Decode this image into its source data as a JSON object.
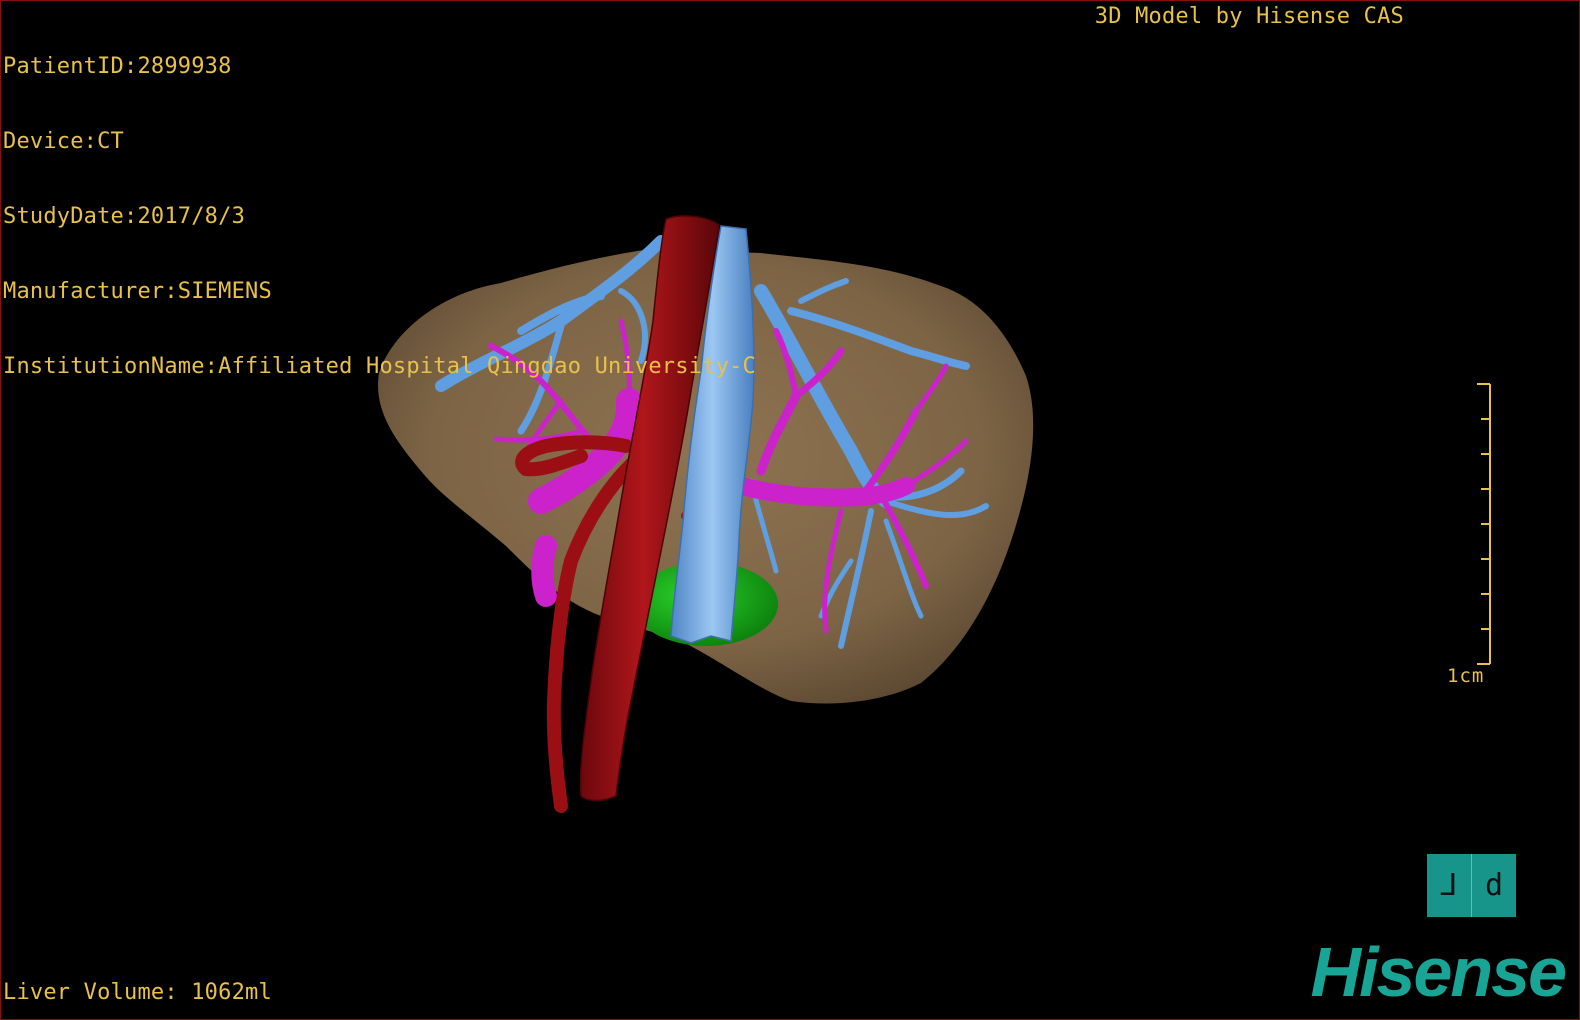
{
  "dicom_info": {
    "patient_id": "PatientID:2899938",
    "device": "Device:CT",
    "study_date": "StudyDate:2017/8/3",
    "manufacturer": "Manufacturer:SIEMENS",
    "institution": "InstitutionName:Affiliated Hospital Qingdao University-C"
  },
  "model_credit": "3D Model by Hisense CAS",
  "liver_volume": "Liver Volume: 1062ml",
  "scale_bar": {
    "label": "1cm"
  },
  "orientation_cube": {
    "left_face": "⅃",
    "right_face": "d"
  },
  "brand": {
    "logo_text": "Hisense"
  },
  "colors": {
    "overlay_text": "#e8c14a",
    "liver": "#8a6f4c",
    "artery": "#9b0f14",
    "vena_cava": "#6ea6e2",
    "portal_vein": "#cc22cc",
    "hepatic_vein": "#5f9ee0",
    "gallbladder": "#13a313",
    "brand": "#18a596",
    "border": "#8a1010"
  }
}
